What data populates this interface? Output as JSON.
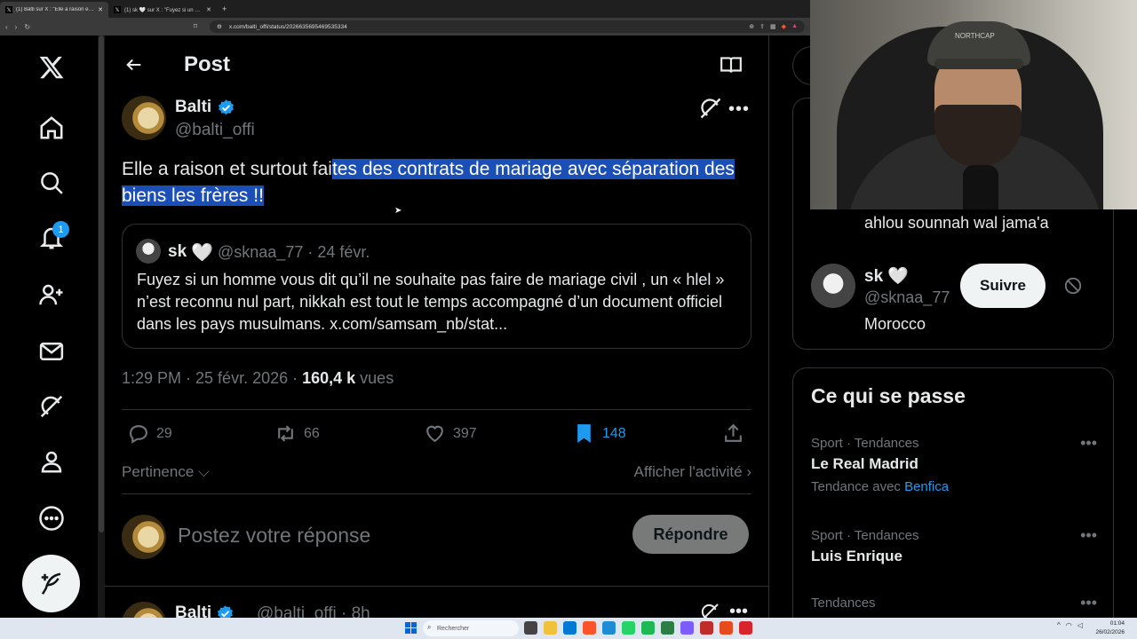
{
  "browser": {
    "tabs": [
      {
        "title": "(1) Balti sur X : \"Elle a raison et surtout",
        "active": true
      },
      {
        "title": "(1) sk 🤍 sur X : \"Fuyez si un homme vous",
        "active": false
      }
    ],
    "url": "x.com/balti_offi/status/2026635695469535334"
  },
  "nav": {
    "notifications_badge": "1"
  },
  "header": {
    "title": "Post"
  },
  "post": {
    "author_name": "Balti",
    "author_handle": "@balti_offi",
    "text_plain": "Elle a raison et surtout fai",
    "text_highlighted": "tes des contrats de mariage avec séparation des biens les frères !!",
    "quote": {
      "name": "sk",
      "heart": "🤍",
      "handle": "@sknaa_77 · 24 févr.",
      "text": "Fuyez si un homme vous dit qu’il ne souhaite pas faire de mariage civil , un « hlel » n’est reconnu nul part, nikkah est tout le temps accompagné d’un document officiel dans les pays musulmans. x.com/samsam_nb/stat..."
    },
    "time": "1:29 PM · 25 févr. 2026 · ",
    "views_count": "160,4 k",
    "views_label": " vues",
    "stats": {
      "replies": "29",
      "reposts": "66",
      "likes": "397",
      "bookmarks": "148"
    }
  },
  "sort": {
    "left": "Pertinence",
    "right": "Afficher l'activité"
  },
  "reply": {
    "placeholder": "Postez votre réponse",
    "button": "Répondre"
  },
  "next_tweet": {
    "name": "Balti",
    "handle": "@balti_offi · 8h"
  },
  "sidebar": {
    "who_bio": "ahlou sounnah wal jama'a",
    "who_name": "sk",
    "who_heart": "🤍",
    "who_handle": "@sknaa_77",
    "who_location": "Morocco",
    "follow_label": "Suivre",
    "trends_title": "Ce qui se passe",
    "trends": [
      {
        "category": "Sport · Tendances",
        "name": "Le Real Madrid",
        "with_label": "Tendance avec",
        "with_link": "Benfica"
      },
      {
        "category": "Sport · Tendances",
        "name": "Luis Enrique"
      },
      {
        "category": "Tendances"
      }
    ]
  },
  "webcam": {
    "cap_text": "NORTHCAP"
  },
  "taskbar": {
    "search_placeholder": "Rechercher",
    "time": "01:04",
    "date": "26/02/2026"
  },
  "colors": {
    "accent": "#1d9bf0",
    "highlight": "#1b4fb8",
    "border": "#2f3336",
    "muted": "#71767b"
  }
}
